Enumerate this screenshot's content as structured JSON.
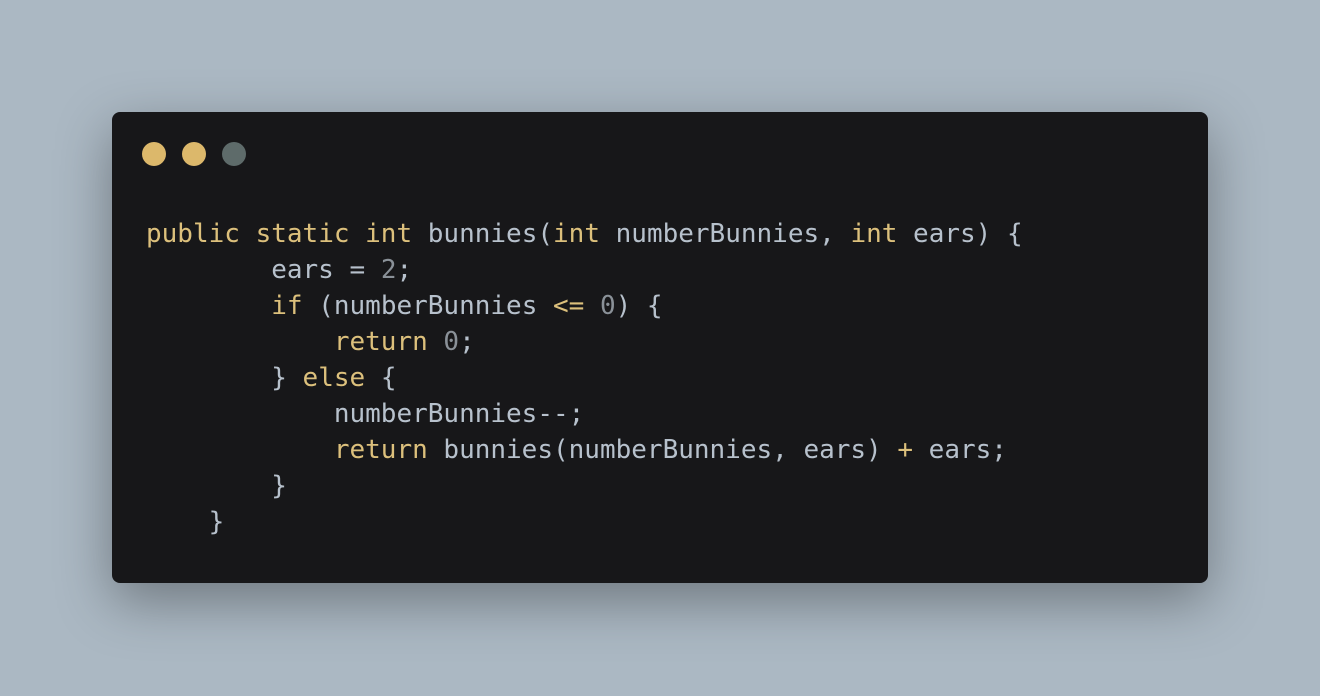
{
  "window_controls": [
    {
      "name": "close-dot",
      "color": "#dcb86b"
    },
    {
      "name": "minimize-dot",
      "color": "#dcb86b"
    },
    {
      "name": "maximize-dot",
      "color": "#5e6b6a"
    }
  ],
  "colors": {
    "background": "#abb8c3",
    "window": "#171719",
    "keyword": "#dcc07c",
    "plain": "#b7c1cc",
    "number": "#8a9198"
  },
  "code": {
    "language": "java",
    "lines": [
      [
        {
          "t": "public",
          "k": "keyword"
        },
        {
          "t": " ",
          "k": "plain"
        },
        {
          "t": "static",
          "k": "keyword"
        },
        {
          "t": " ",
          "k": "plain"
        },
        {
          "t": "int",
          "k": "keyword"
        },
        {
          "t": " bunnies(",
          "k": "plain"
        },
        {
          "t": "int",
          "k": "keyword"
        },
        {
          "t": " numberBunnies, ",
          "k": "plain"
        },
        {
          "t": "int",
          "k": "keyword"
        },
        {
          "t": " ears) {",
          "k": "plain"
        }
      ],
      [
        {
          "t": "        ears = ",
          "k": "plain"
        },
        {
          "t": "2",
          "k": "number"
        },
        {
          "t": ";",
          "k": "plain"
        }
      ],
      [
        {
          "t": "        ",
          "k": "plain"
        },
        {
          "t": "if",
          "k": "keyword"
        },
        {
          "t": " (numberBunnies ",
          "k": "plain"
        },
        {
          "t": "<=",
          "k": "keyword"
        },
        {
          "t": " ",
          "k": "plain"
        },
        {
          "t": "0",
          "k": "number"
        },
        {
          "t": ") {",
          "k": "plain"
        }
      ],
      [
        {
          "t": "            ",
          "k": "plain"
        },
        {
          "t": "return",
          "k": "keyword"
        },
        {
          "t": " ",
          "k": "plain"
        },
        {
          "t": "0",
          "k": "number"
        },
        {
          "t": ";",
          "k": "plain"
        }
      ],
      [
        {
          "t": "        } ",
          "k": "plain"
        },
        {
          "t": "else",
          "k": "keyword"
        },
        {
          "t": " {",
          "k": "plain"
        }
      ],
      [
        {
          "t": "            numberBunnies--;",
          "k": "plain"
        }
      ],
      [
        {
          "t": "            ",
          "k": "plain"
        },
        {
          "t": "return",
          "k": "keyword"
        },
        {
          "t": " bunnies(numberBunnies, ears) ",
          "k": "plain"
        },
        {
          "t": "+",
          "k": "keyword"
        },
        {
          "t": " ears;",
          "k": "plain"
        }
      ],
      [
        {
          "t": "        }",
          "k": "plain"
        }
      ],
      [
        {
          "t": "    }",
          "k": "plain"
        }
      ]
    ]
  }
}
